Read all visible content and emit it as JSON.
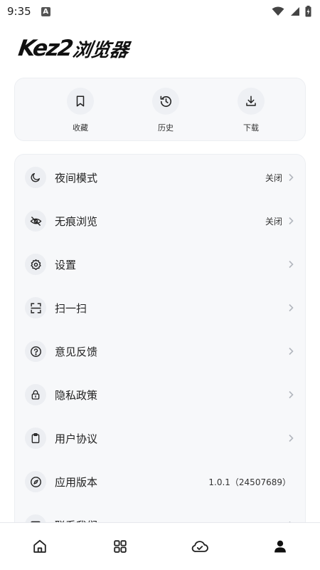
{
  "status_bar": {
    "time": "9:35",
    "badge": "A"
  },
  "logo": {
    "latin": "Kez2",
    "cjk": "浏览器"
  },
  "quick_actions": [
    {
      "label": "收藏",
      "icon": "bookmark-icon"
    },
    {
      "label": "历史",
      "icon": "history-icon"
    },
    {
      "label": "下载",
      "icon": "download-icon"
    }
  ],
  "menu": [
    {
      "label": "夜间模式",
      "value": "关闭",
      "icon": "moon-icon"
    },
    {
      "label": "无痕浏览",
      "value": "关闭",
      "icon": "eye-off-icon"
    },
    {
      "label": "设置",
      "value": "",
      "icon": "gear-icon"
    },
    {
      "label": "扫一扫",
      "value": "",
      "icon": "scan-icon"
    },
    {
      "label": "意见反馈",
      "value": "",
      "icon": "help-circle-icon"
    },
    {
      "label": "隐私政策",
      "value": "",
      "icon": "lock-icon"
    },
    {
      "label": "用户协议",
      "value": "",
      "icon": "clipboard-icon"
    },
    {
      "label": "应用版本",
      "value": "1.0.1（24507689）",
      "icon": "compass-icon"
    },
    {
      "label": "联系我们",
      "value": "",
      "icon": "mail-icon"
    }
  ],
  "bottom_nav": [
    {
      "icon": "home-icon"
    },
    {
      "icon": "grid-icon"
    },
    {
      "icon": "cloud-check-icon"
    },
    {
      "icon": "user-icon",
      "active": true
    }
  ],
  "colors": {
    "background": "#ffffff",
    "card": "#f7f8fa",
    "icon_bg": "#eceef2",
    "text": "#222222"
  }
}
